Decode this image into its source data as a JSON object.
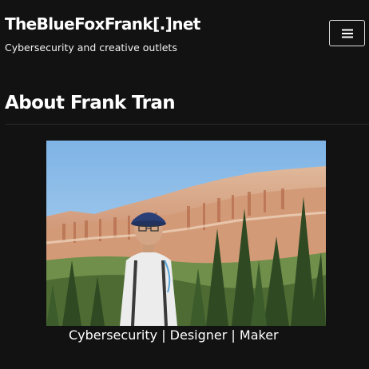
{
  "header": {
    "site_title": "TheBlueFoxFrank[.]net",
    "tagline": "Cybersecurity and creative outlets",
    "menu_icon": "hamburger-menu-icon"
  },
  "main": {
    "page_title": "About Frank Tran",
    "photo_description_icon": "profile-photo",
    "caption": "Cybersecurity | Designer | Maker"
  },
  "colors": {
    "background": "#121212",
    "text": "#ffffff",
    "button_border": "#d9d9d9"
  }
}
